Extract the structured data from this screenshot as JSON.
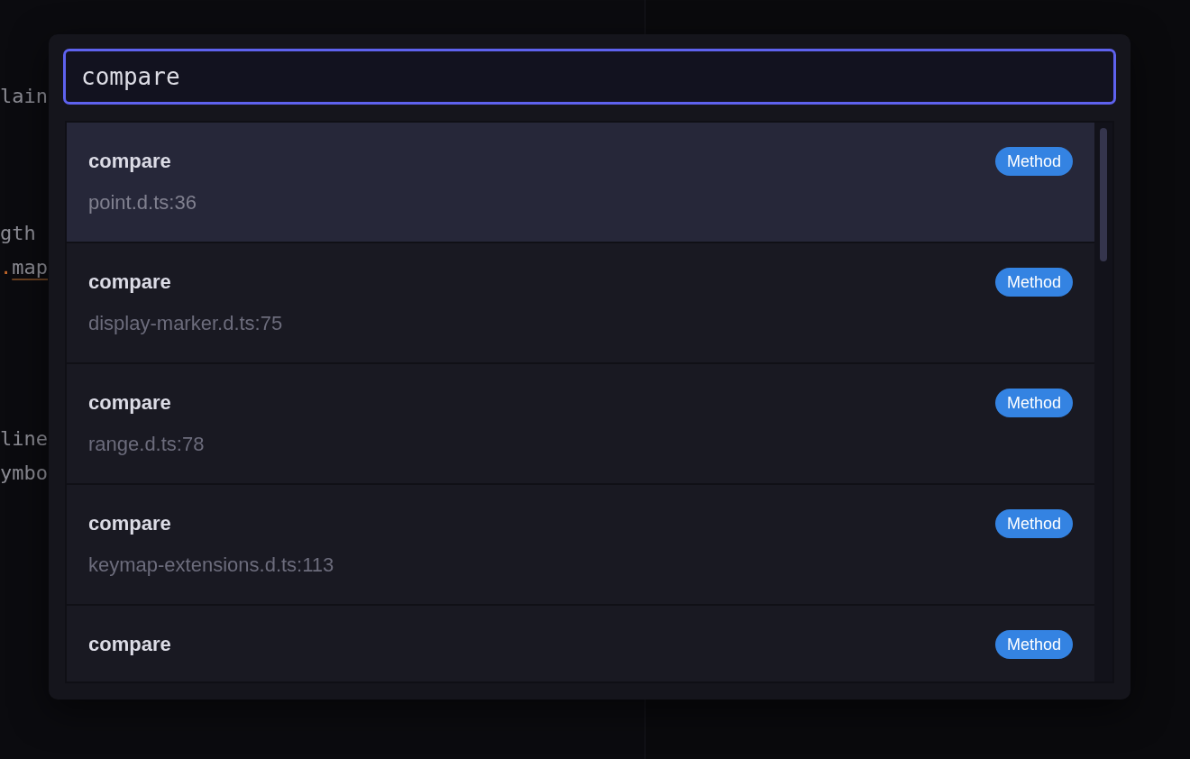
{
  "editor": {
    "lines": [
      {
        "tokens": [
          {
            "text": "lain",
            "kind": "plain"
          }
        ]
      },
      {
        "tokens": [
          {
            "text": "gth",
            "kind": "plain"
          }
        ]
      },
      {
        "tokens": [
          {
            "text": ".",
            "kind": "operator"
          },
          {
            "text": "map",
            "kind": "flagged"
          }
        ]
      },
      {
        "tokens": [
          {
            "text": "line",
            "kind": "plain"
          }
        ]
      },
      {
        "tokens": [
          {
            "text": "ymbo",
            "kind": "plain"
          }
        ]
      }
    ]
  },
  "palette": {
    "query": "compare",
    "results": [
      {
        "title": "compare",
        "location": "point.d.ts:36",
        "badge": "Method",
        "selected": true
      },
      {
        "title": "compare",
        "location": "display-marker.d.ts:75",
        "badge": "Method",
        "selected": false
      },
      {
        "title": "compare",
        "location": "range.d.ts:78",
        "badge": "Method",
        "selected": false
      },
      {
        "title": "compare",
        "location": "keymap-extensions.d.ts:113",
        "badge": "Method",
        "selected": false
      },
      {
        "title": "compare",
        "badge": "Method",
        "selected": false
      }
    ]
  }
}
